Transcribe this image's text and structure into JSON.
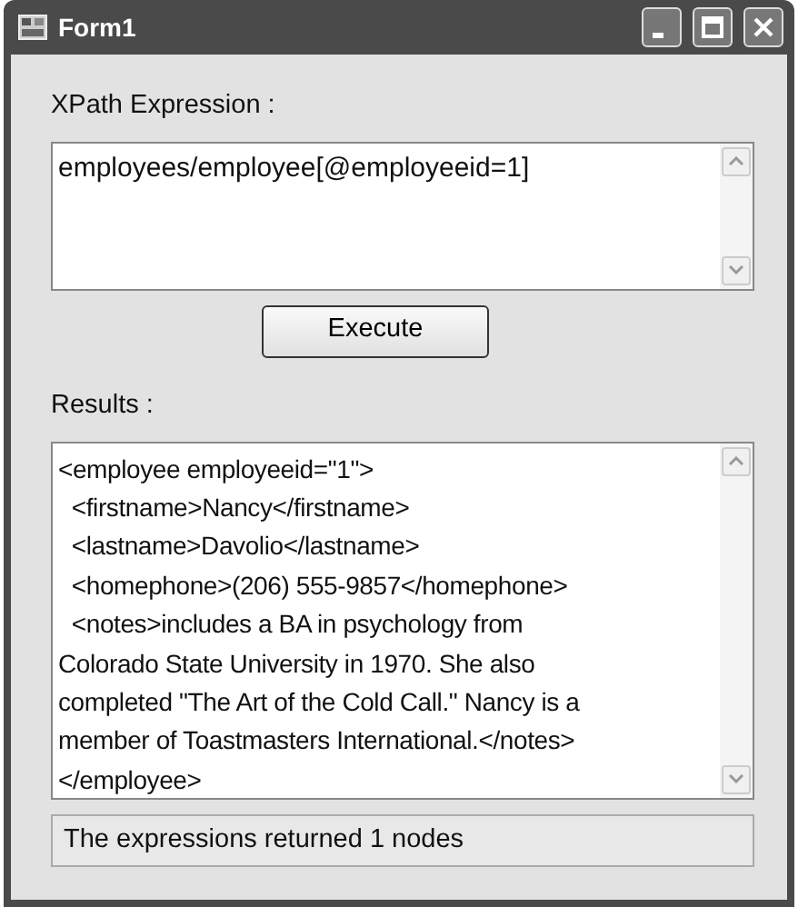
{
  "window": {
    "title": "Form1"
  },
  "expression": {
    "label": "XPath Expression :",
    "value": "employees/employee[@employeeid=1]"
  },
  "execute_button": {
    "label": "Execute"
  },
  "results": {
    "label": "Results :",
    "lines": [
      "<employee employeeid=\"1\">",
      "  <firstname>Nancy</firstname>",
      "  <lastname>Davolio</lastname>",
      "  <homephone>(206) 555-9857</homephone>",
      "  <notes>includes a BA in psychology from",
      "Colorado State University in 1970. She also",
      "completed \"The Art of the Cold Call.\" Nancy is a",
      "member of Toastmasters International.</notes>",
      "</employee>"
    ]
  },
  "status": "The expressions returned 1 nodes"
}
